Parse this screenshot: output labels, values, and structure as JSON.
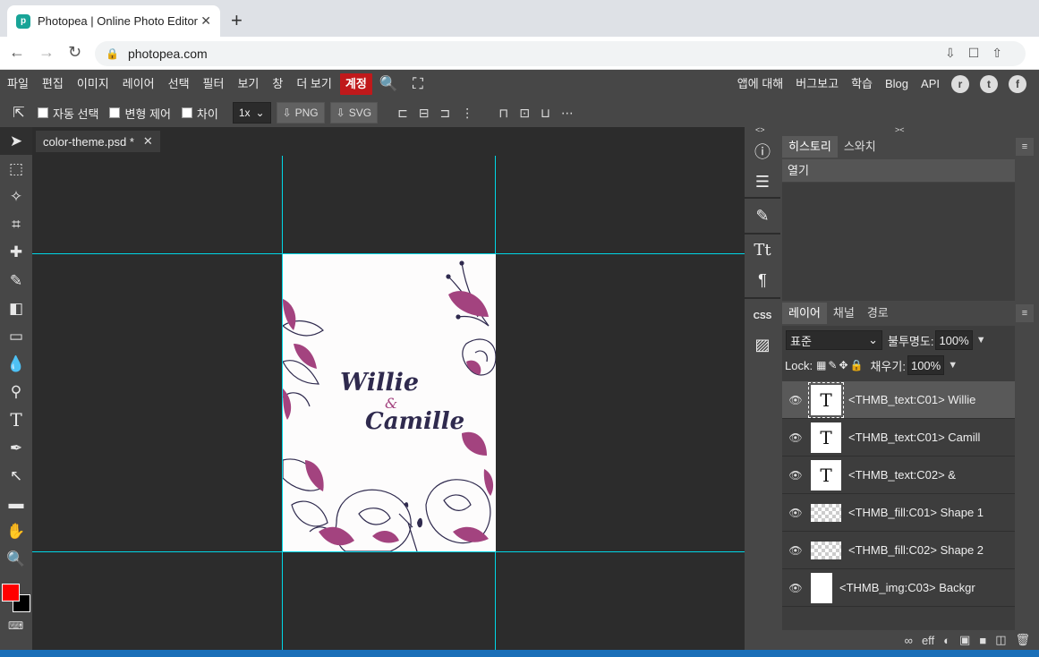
{
  "browser": {
    "tab_title": "Photopea | Online Photo Editor",
    "tab_close": "✕",
    "new_tab": "+",
    "url": "photopea.com"
  },
  "menubar": {
    "items": [
      "파일",
      "편집",
      "이미지",
      "레이어",
      "선택",
      "필터",
      "보기",
      "창",
      "더 보기"
    ],
    "account": "계정",
    "right_items": [
      "앱에 대해",
      "버그보고",
      "학습",
      "Blog",
      "API"
    ]
  },
  "options": {
    "auto_select": "자동 선택",
    "transform_controls": "변형 제어",
    "distances": "차이",
    "zoom": "1x",
    "png": "PNG",
    "svg": "SVG"
  },
  "document": {
    "tab_label": "color-theme.psd *",
    "tab_close": "✕",
    "text_line1": "Willie",
    "text_amp": "&",
    "text_line2": "Camille",
    "flower_color": "#a3437f",
    "ink_color": "#2f2a4e",
    "guide_color": "#00d7e6"
  },
  "history_panel": {
    "tabs": [
      "히스토리",
      "스와치"
    ],
    "items": [
      "열기"
    ]
  },
  "layers_panel": {
    "tabs": [
      "레이어",
      "채널",
      "경로"
    ],
    "blend_mode": "표준",
    "opacity_label": "불투명도:",
    "opacity_value": "100%",
    "lock_label": "Lock:",
    "fill_label": "채우기:",
    "fill_value": "100%",
    "layers": [
      {
        "name": "<THMB_text:C01> Willie",
        "thumb": "T"
      },
      {
        "name": "<THMB_text:C01> Camill",
        "thumb": "T"
      },
      {
        "name": "<THMB_text:C02> &",
        "thumb": "T"
      },
      {
        "name": "<THMB_fill:C01> Shape 1",
        "thumb": ""
      },
      {
        "name": "<THMB_fill:C02> Shape 2",
        "thumb": ""
      },
      {
        "name": "<THMB_img:C03> Backgr",
        "thumb": ""
      }
    ],
    "footer": [
      "∞",
      "eff",
      "◐",
      "▣",
      "■",
      "◫",
      "🗑"
    ]
  },
  "colors": {
    "foreground": "#ff0000",
    "background": "#000000",
    "account_button": "#c0191b"
  }
}
